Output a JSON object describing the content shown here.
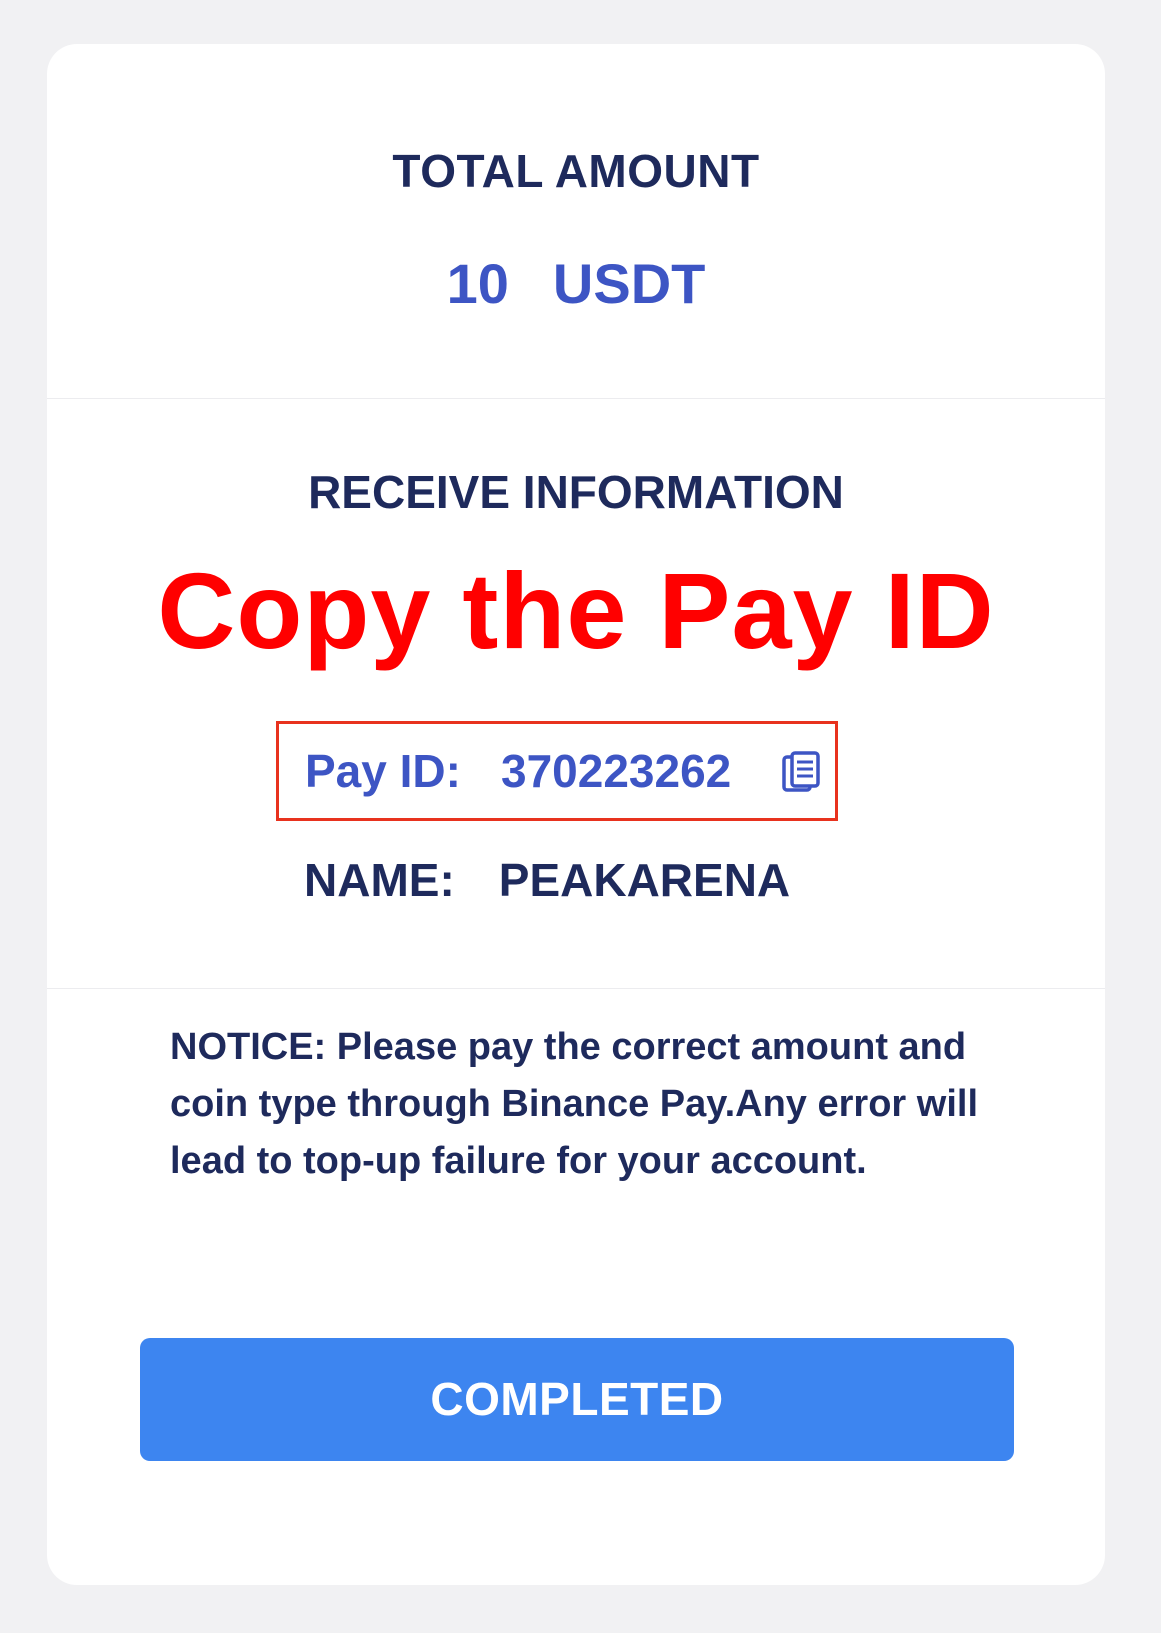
{
  "amount": {
    "label": "TOTAL AMOUNT",
    "value": "10",
    "currency": "USDT"
  },
  "receive": {
    "label": "RECEIVE INFORMATION",
    "annotation": "Copy the Pay ID",
    "pay_id_label": "Pay ID:",
    "pay_id_value": "370223262",
    "name_label": "NAME:",
    "name_value": "PEAKARENA"
  },
  "notice": {
    "text": "NOTICE: Please pay the correct amount and coin type through Binance Pay.Any error will lead to top-up failure for your account."
  },
  "actions": {
    "completed_label": "COMPLETED"
  },
  "colors": {
    "accent": "#3d55c4",
    "heading": "#1e2a5c",
    "annotation": "#ff0000",
    "button": "#3d85f0",
    "highlight_border": "#e8321e"
  },
  "icons": {
    "copy": "copy-icon"
  }
}
